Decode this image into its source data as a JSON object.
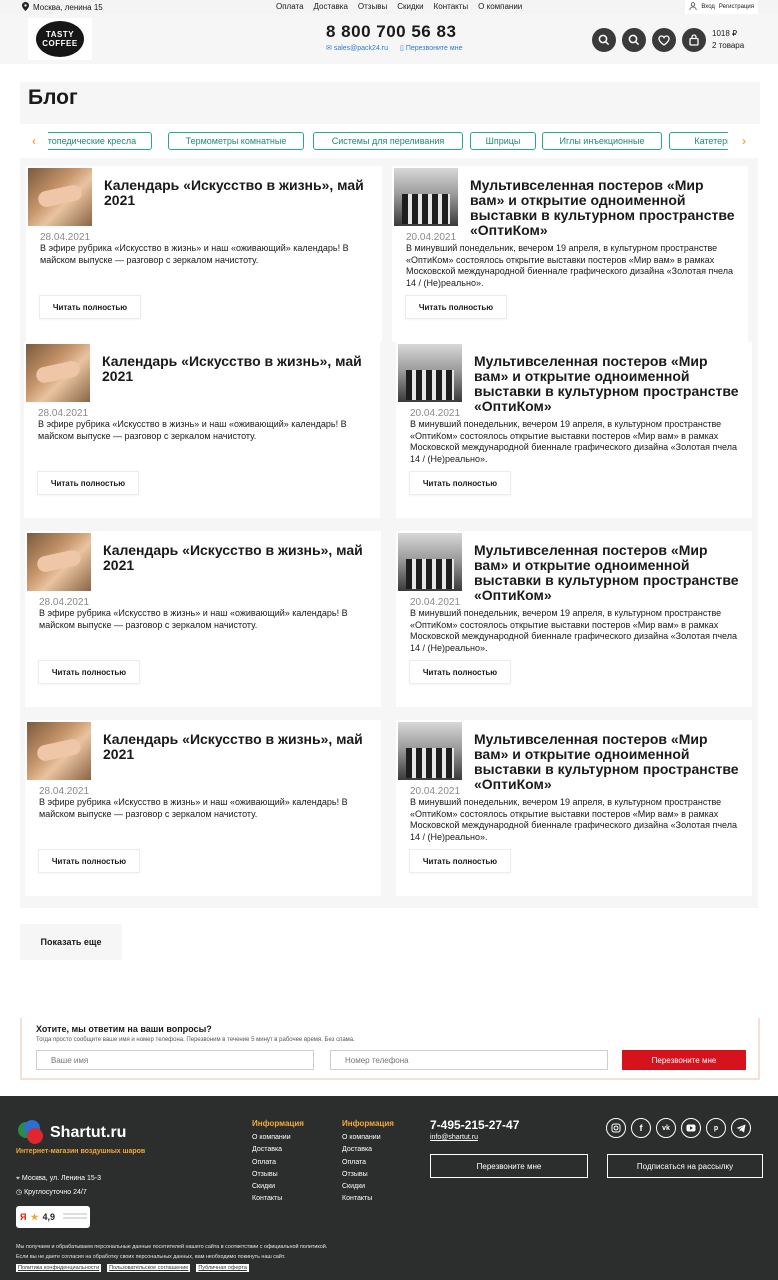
{
  "topbar": {
    "address": "Москва, ленина 15",
    "nav": [
      "Оплата",
      "Доставка",
      "Отзывы",
      "Скидки",
      "Контакты",
      "О компании"
    ],
    "login": "Вход",
    "register": "Регистрация"
  },
  "header": {
    "logo_line1": "TASTY",
    "logo_line2": "COFFEE",
    "phone": "8 800 700 56 83",
    "email": "sales@pack24.ru",
    "callback": "Перезвоните мне",
    "cart_total": "1018 ₽",
    "cart_count": "2 товара"
  },
  "page": {
    "title": "Блог"
  },
  "tags": [
    "Ортопедические кресла",
    "Термометры комнатные",
    "Системы для переливания",
    "Шприцы",
    "Иглы инъекционные",
    "Катетеры"
  ],
  "posts": {
    "a": {
      "title": "Календарь «Искусство в жизнь», май 2021",
      "date": "28.04.2021",
      "text": "В эфире рубрика «Искусство в жизнь» и наш «оживающий» календарь! В майском выпуске — разговор с зеркалом начистоту."
    },
    "b": {
      "title": "Мультивселенная постеров «Мир вам» и открытие одноименной выставки в культурном пространстве «ОптиКом»",
      "date": "20.04.2021",
      "text": "В минувший понедельник, вечером 19 апреля, в культурном пространстве «ОптиКом» состоялось открытие выставки постеров «Мир вам» в рамках Московской международной биеннале графического дизайна «Золотая пчела 14 / (Не)реально»."
    },
    "read_more": "Читать полностью"
  },
  "show_more": "Показать еще",
  "callback_form": {
    "heading": "Хотите, мы ответим на ваши вопросы?",
    "subheading": "Тогда просто сообщите ваше имя и номер телефона. Перезвоним в течение 5 минут в рабочее время. Без спама.",
    "name_placeholder": "Ваше имя",
    "phone_placeholder": "Номер телефона",
    "submit": "Перезвоните мне"
  },
  "footer": {
    "brand": "Shartut.ru",
    "slogan": "Интернет-магазин воздушных шаров",
    "address": "Москва, ул. Ленина 15-3",
    "hours": "Круглосуточно 24/7",
    "rating": "4,9",
    "col1": {
      "heading": "Информация",
      "items": [
        "О компании",
        "Доставка",
        "Оплата",
        "Отзывы",
        "Скидки",
        "Контакты"
      ]
    },
    "col2": {
      "heading": "Информация",
      "items": [
        "О компании",
        "Доставка",
        "Оплата",
        "Отзывы",
        "Скидки",
        "Контакты"
      ]
    },
    "phone": "7-495-215-27-47",
    "email": "info@shartut.ru",
    "callback_btn": "Перезвоните мне",
    "subscribe_btn": "Подписаться на рассылку",
    "legal_1": "Мы получаем и обрабатываем персональные данные посетителей нашего сайта в соответствии с официальной политикой.",
    "legal_2": "Если вы не даете согласия на обработку своих персональных данных, вам необходимо покинуть наш сайт.",
    "link_privacy": "Политика конфиденциальности",
    "link_terms": "Пользовательское соглашение",
    "link_offer": "Публичная оферта"
  },
  "colors": {
    "accent_orange": "#f2a93b",
    "tag_green": "#2aa58f",
    "cta_red": "#d6131c",
    "footer_bg": "#2b2e2c"
  }
}
